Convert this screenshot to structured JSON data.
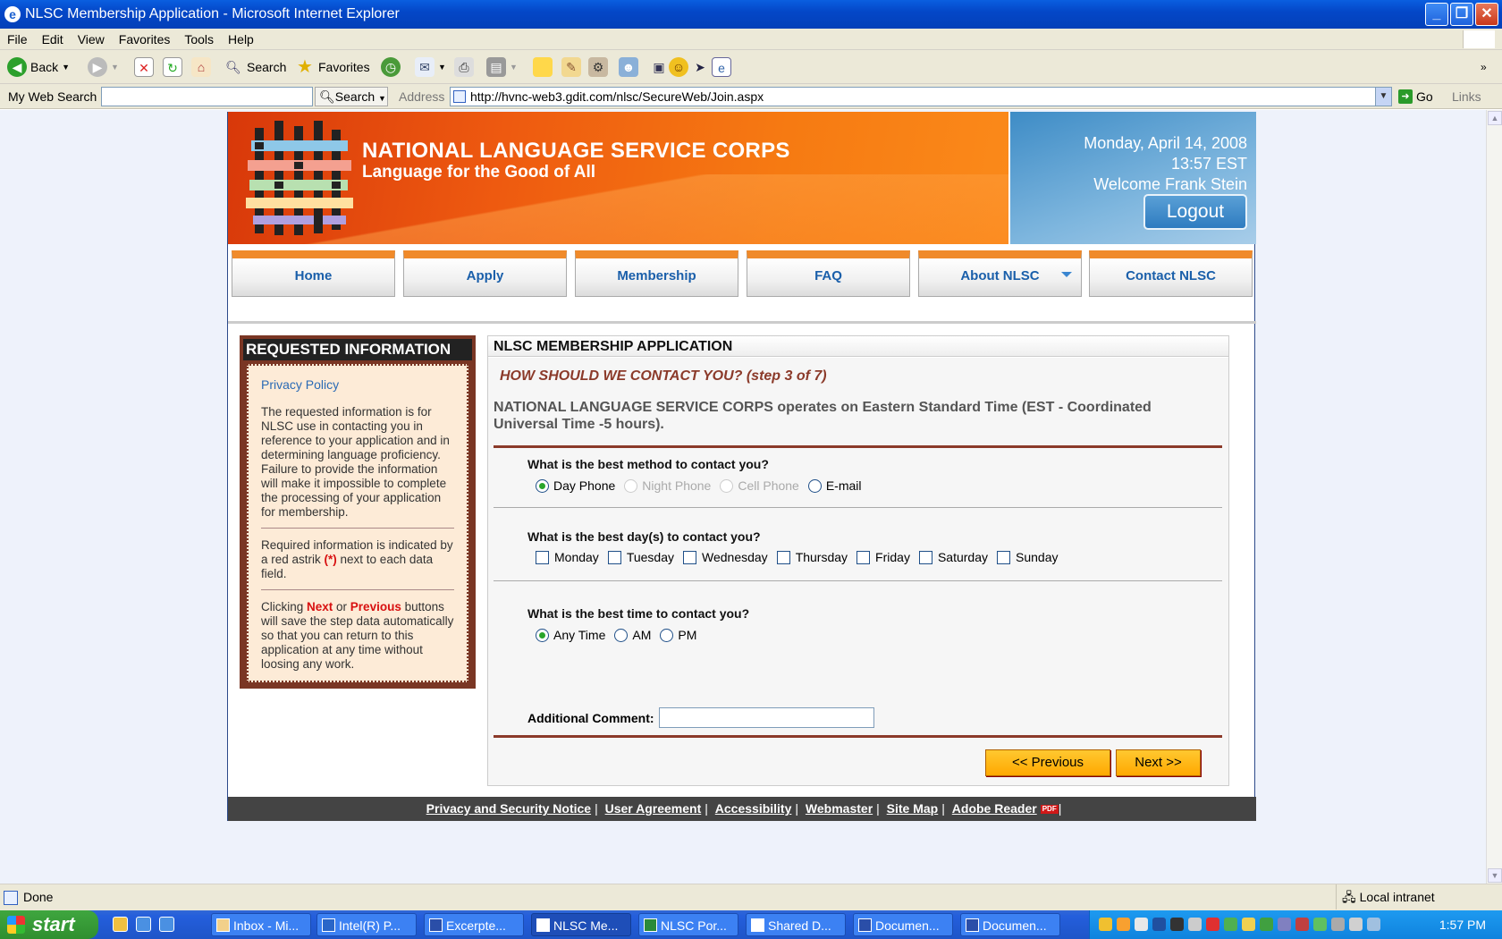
{
  "window": {
    "title": "NLSC Membership Application - Microsoft Internet Explorer"
  },
  "menubar": [
    "File",
    "Edit",
    "View",
    "Favorites",
    "Tools",
    "Help"
  ],
  "toolbar": {
    "back": "Back",
    "search": "Search",
    "favorites": "Favorites"
  },
  "addressbar": {
    "web_search_label": "My Web Search",
    "search_button": "Search",
    "address_label": "Address",
    "url": "http://hvnc-web3.gdit.com/nlsc/SecureWeb/Join.aspx",
    "go": "Go",
    "links": "Links"
  },
  "banner": {
    "org_name": "NATIONAL LANGUAGE SERVICE CORPS",
    "tagline": "Language for the Good of All",
    "date": "Monday, April 14, 2008",
    "time": "13:57 EST",
    "welcome": "Welcome Frank Stein",
    "logout": "Logout"
  },
  "nav": {
    "items": [
      "Home",
      "Apply",
      "Membership",
      "FAQ",
      "About NLSC",
      "Contact NLSC"
    ]
  },
  "sidebar": {
    "title": "REQUESTED INFORMATION",
    "privacy_link": "Privacy Policy",
    "para1": "The requested information is for NLSC use in contacting you in reference to your application and in determining language proficiency. Failure to provide the information will make it impossible to complete the processing of your application for membership.",
    "para2_a": "Required information is indicated by a red astrik ",
    "para2_mark": "(*)",
    "para2_b": " next to each data field.",
    "para3_a": "Clicking ",
    "para3_next": "Next",
    "para3_or": " or ",
    "para3_prev": "Previous",
    "para3_b": " buttons will save the step data automatically so that you can return to this application at any time without loosing any work."
  },
  "form": {
    "title": "NLSC MEMBERSHIP APPLICATION",
    "step": "HOW SHOULD WE CONTACT YOU? (step 3 of 7)",
    "timezone_note": "NATIONAL LANGUAGE SERVICE CORPS operates on Eastern Standard Time (EST - Coordinated Universal Time -5 hours).",
    "q_method": "What is the best method to contact you?",
    "method_options": [
      "Day Phone",
      "Night Phone",
      "Cell Phone",
      "E-mail"
    ],
    "method_selected": "Day Phone",
    "q_days": "What is the best day(s) to contact you?",
    "days": [
      "Monday",
      "Tuesday",
      "Wednesday",
      "Thursday",
      "Friday",
      "Saturday",
      "Sunday"
    ],
    "q_time": "What is the best time to contact you?",
    "time_options": [
      "Any Time",
      "AM",
      "PM"
    ],
    "time_selected": "Any Time",
    "comment_label": "Additional Comment:",
    "comment_value": "",
    "prev_button": "<< Previous",
    "next_button": "Next >>"
  },
  "footer": {
    "links": [
      "Privacy and Security Notice",
      "User Agreement",
      "Accessibility",
      "Webmaster",
      "Site Map",
      "Adobe Reader"
    ],
    "pdf_badge": "PDF"
  },
  "statusbar": {
    "status": "Done",
    "zone": "Local intranet"
  },
  "taskbar": {
    "start": "start",
    "tasks": [
      "Inbox - Mi...",
      "Intel(R) P...",
      "Excerpte...",
      "NLSC Me...",
      "NLSC Por...",
      "Shared D...",
      "Documen...",
      "Documen..."
    ],
    "clock": "1:57 PM"
  },
  "colors": {
    "banner_orange": "#ee5a10",
    "nav_accent": "#f08a2a",
    "sidebar_brown": "#7a3624",
    "button_yellow": "#ffa800",
    "link_blue": "#1a5faa"
  }
}
